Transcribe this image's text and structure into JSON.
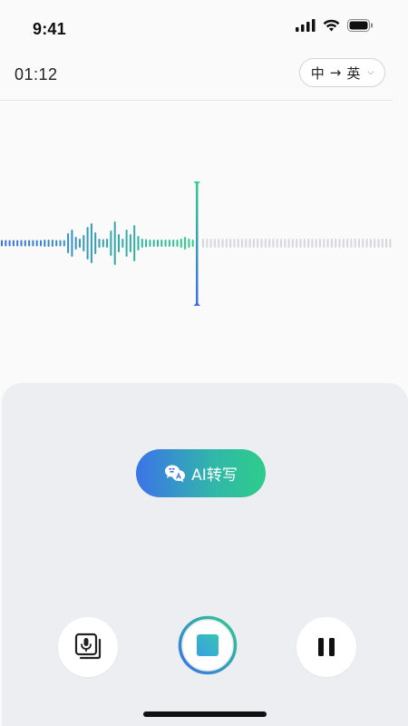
{
  "status_bar": {
    "time": "9:41",
    "icons": [
      "signal-icon",
      "wifi-icon",
      "battery-icon"
    ]
  },
  "recording": {
    "elapsed": "01:12"
  },
  "language": {
    "source": "中",
    "target": "英",
    "arrow": "→"
  },
  "waveform": {
    "recorded_color_start": "#3b6fe0",
    "recorded_color_end": "#2ecc8a",
    "pending_color": "#d5d7dd",
    "playhead_color_top": "#2ecc8a",
    "playhead_color_bottom": "#3b6fe0"
  },
  "ai_button": {
    "label": "AI转写",
    "icon": "translate-icon"
  },
  "controls": {
    "left": "mic-copy-icon",
    "center": "stop-icon",
    "right": "pause-icon"
  },
  "colors": {
    "accent_blue": "#3b73e8",
    "accent_green": "#2ecc8a",
    "panel_bg": "#eceef2"
  }
}
